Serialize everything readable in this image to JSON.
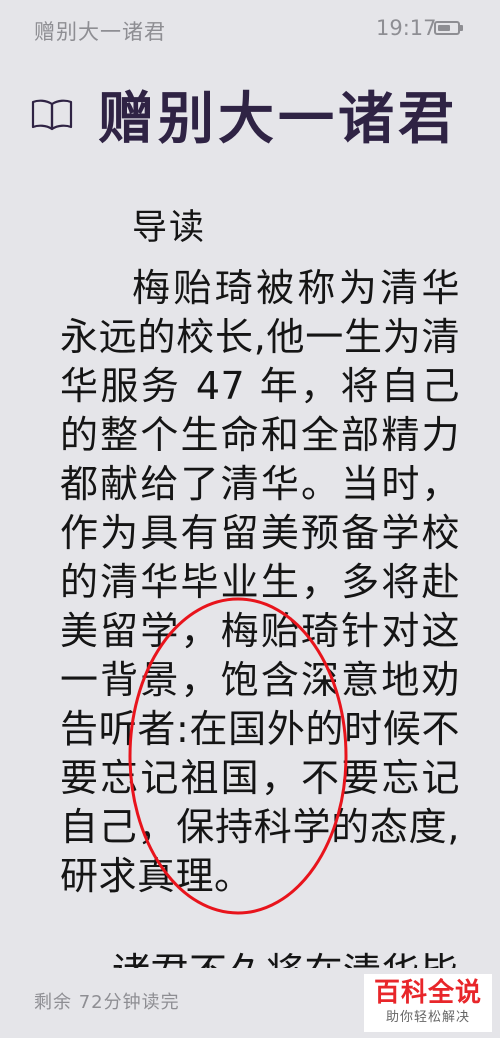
{
  "status_bar": {
    "title": "赠别大一诸君",
    "time": "19:17",
    "battery_icon": "battery-icon"
  },
  "header": {
    "icon": "book-icon",
    "title": "赠别大一诸君"
  },
  "content": {
    "section_heading": "导读",
    "paragraph_1": "梅贻琦被称为清华永远的校长,他一生为清华服务 47 年，将自己的整个生命和全部精力都献给了清华。当时，作为具有留美预备学校的清华毕业生，多将赴美留学，梅贻琦针对这一背景，饱含深意地劝告听者:在国外的时候不要忘记祖国，不要忘记自己，保持科学的态度,研求真理。",
    "paragraph_2": "诸君不久将在清华毕"
  },
  "annotation": {
    "color": "#e8141c",
    "shape": "ellipse"
  },
  "footer": {
    "reading_time": "剩余 72分钟读完"
  },
  "watermark": {
    "main": "百科全说",
    "sub": "助你轻松解决"
  }
}
